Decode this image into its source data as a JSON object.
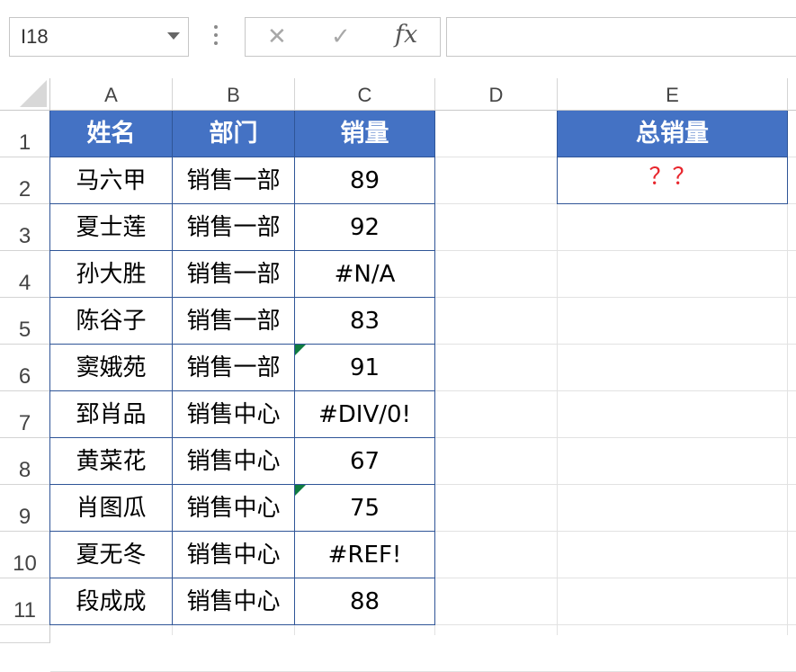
{
  "formula_bar": {
    "name_box": "I18",
    "cancel_icon": "✕",
    "enter_icon": "✓",
    "fx_label": "fx",
    "formula": ""
  },
  "columns": [
    "A",
    "B",
    "C",
    "D",
    "E"
  ],
  "rows": [
    "1",
    "2",
    "3",
    "4",
    "5",
    "6",
    "7",
    "8",
    "9",
    "10",
    "11"
  ],
  "table": {
    "headers": [
      "姓名",
      "部门",
      "销量"
    ],
    "rows": [
      [
        "马六甲",
        "销售一部",
        "89"
      ],
      [
        "夏士莲",
        "销售一部",
        "92"
      ],
      [
        "孙大胜",
        "销售一部",
        "#N/A"
      ],
      [
        "陈谷子",
        "销售一部",
        "83"
      ],
      [
        "窦娥苑",
        "销售一部",
        "91"
      ],
      [
        "郅肖品",
        "销售中心",
        "#DIV/0!"
      ],
      [
        "黄菜花",
        "销售中心",
        "67"
      ],
      [
        "肖图瓜",
        "销售中心",
        "75"
      ],
      [
        "夏无冬",
        "销售中心",
        "#REF!"
      ],
      [
        "段成成",
        "销售中心",
        "88"
      ]
    ],
    "error_indicator_rows": [
      6,
      9
    ]
  },
  "summary": {
    "header": "总销量",
    "value": "？？"
  },
  "colors": {
    "header_fill": "#4472c4",
    "header_text": "#ffffff",
    "table_border": "#2f5597",
    "question_mark": "#e8262d",
    "error_indicator": "#107c41"
  }
}
